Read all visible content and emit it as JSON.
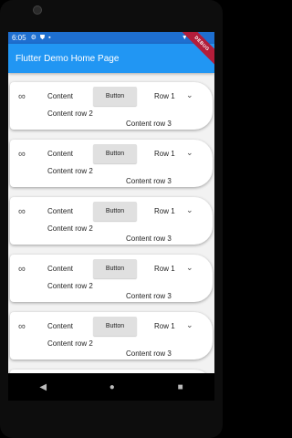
{
  "status_bar": {
    "time": "6:05",
    "icons_left": [
      "gear-icon",
      "shield-icon",
      "sd-card-icon"
    ],
    "icons_right": [
      "wifi-icon",
      "signal-icon",
      "battery-icon"
    ]
  },
  "app_bar": {
    "title": "Flutter Demo Home Page",
    "debug_banner": "DEBUG"
  },
  "cards": [
    {
      "content": "Content",
      "button": "Button",
      "row1": "Row 1",
      "row2": "Content row 2",
      "row3": "Content row 3"
    },
    {
      "content": "Content",
      "button": "Button",
      "row1": "Row 1",
      "row2": "Content row 2",
      "row3": "Content row 3"
    },
    {
      "content": "Content",
      "button": "Button",
      "row1": "Row 1",
      "row2": "Content row 2",
      "row3": "Content row 3"
    },
    {
      "content": "Content",
      "button": "Button",
      "row1": "Row 1",
      "row2": "Content row 2",
      "row3": "Content row 3"
    },
    {
      "content": "Content",
      "button": "Button",
      "row1": "Row 1",
      "row2": "Content row 2",
      "row3": "Content row 3"
    },
    {
      "content": "",
      "button": "",
      "row1": "",
      "row2": "",
      "row3": ""
    }
  ],
  "nav_bar": {
    "icons": [
      "back-icon",
      "home-icon",
      "recents-icon"
    ]
  }
}
